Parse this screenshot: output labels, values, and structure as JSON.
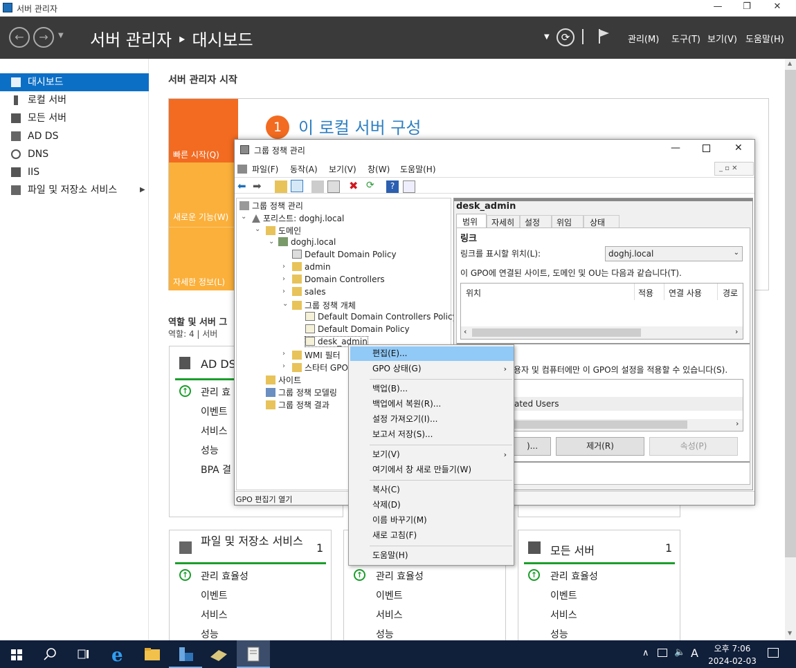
{
  "window": {
    "title": "서버 관리자",
    "min": "—",
    "max": "❐",
    "close": "✕"
  },
  "header": {
    "back": "←",
    "forward": "→",
    "title": "서버 관리자 ‣ 대시보드",
    "refresh": "⟳",
    "menus": [
      "관리(M)",
      "도구(T)",
      "보기(V)",
      "도움말(H)"
    ]
  },
  "nav": {
    "items": [
      {
        "label": "대시보드"
      },
      {
        "label": "로컬 서버"
      },
      {
        "label": "모든 서버"
      },
      {
        "label": "AD DS"
      },
      {
        "label": "DNS"
      },
      {
        "label": "IIS"
      },
      {
        "label": "파일 및 저장소 서비스"
      }
    ]
  },
  "main": {
    "start_title": "서버 관리자 시작",
    "quick_start": "빠른 시작(Q)",
    "new_features": "새로운 기능(W)",
    "learn_more": "자세한 정보(L)",
    "step_num": "1",
    "step_text": "이 로컬 서버 구성",
    "roles_title": "역할 및 서버 그",
    "roles_sub": "역할: 4  |  서버",
    "tiles": [
      {
        "title": "AD DS",
        "rows": [
          "관리 효",
          "이벤트",
          "서비스",
          "성능",
          "BPA 결"
        ]
      },
      {
        "title": "파일 및 저장소 서비스",
        "count": "1",
        "rows": [
          "관리 효율성",
          "이벤트",
          "서비스",
          "성능"
        ]
      },
      {
        "rows": [
          "관리 효율성",
          "이벤트",
          "서비스",
          "성능"
        ]
      },
      {
        "title": "모든 서버",
        "count": "1",
        "rows": [
          "관리 효율성",
          "이벤트",
          "서비스",
          "성능"
        ]
      }
    ]
  },
  "gpmc": {
    "title": "그룹 정책 관리",
    "menu": [
      "파일(F)",
      "동작(A)",
      "보기(V)",
      "창(W)",
      "도움말(H)"
    ],
    "tree": [
      "그룹 정책 관리",
      "포리스트: doghj.local",
      "도메인",
      "doghj.local",
      "Default Domain Policy",
      "admin",
      "Domain Controllers",
      "sales",
      "그룹 정책 개체",
      "Default Domain Controllers Policy",
      "Default Domain Policy",
      "desk_admin",
      "WMI 필터",
      "스타터 GPO",
      "사이트",
      "그룹 정책 모델링",
      "그룹 정책 결과"
    ],
    "status": "GPO 편집기 열기",
    "right": {
      "heading": "desk_admin",
      "tabs": [
        "범위",
        "자세히",
        "설정",
        "위임",
        "상태"
      ],
      "links_title": "링크",
      "links_label": "링크를 표시할 위치(L):",
      "links_value": "doghj.local",
      "links_desc": "이 GPO에 연결된 사이트, 도메인 및 OU는 다음과 같습니다(T).",
      "cols": [
        "위치",
        "적용",
        "연결 사용",
        "경로"
      ],
      "filter_text": "용자 및 컴퓨터에만 이 GPO의 설정을 적용할 수 있습니다(S).",
      "filter_item": "ated Users",
      "btn_add": ")...",
      "btn_remove": "제거(R)",
      "btn_props": "속성(P)"
    }
  },
  "context_menu": {
    "items": [
      "편집(E)...",
      "GPO 상태(G)",
      "백업(B)...",
      "백업에서 복원(R)...",
      "설정 가져오기(I)...",
      "보고서 저장(S)...",
      "보기(V)",
      "여기에서 창 새로 만들기(W)",
      "복사(C)",
      "삭제(D)",
      "이름 바꾸기(M)",
      "새로 고침(F)",
      "도움말(H)"
    ]
  },
  "taskbar": {
    "time": "오후 7:06",
    "date": "2024-02-03",
    "ime": "A"
  },
  "colors": {
    "accent": "#0c6fc6",
    "orange": "#f26b21",
    "orange_light": "#fbb03b",
    "green": "#1a9e2a"
  }
}
